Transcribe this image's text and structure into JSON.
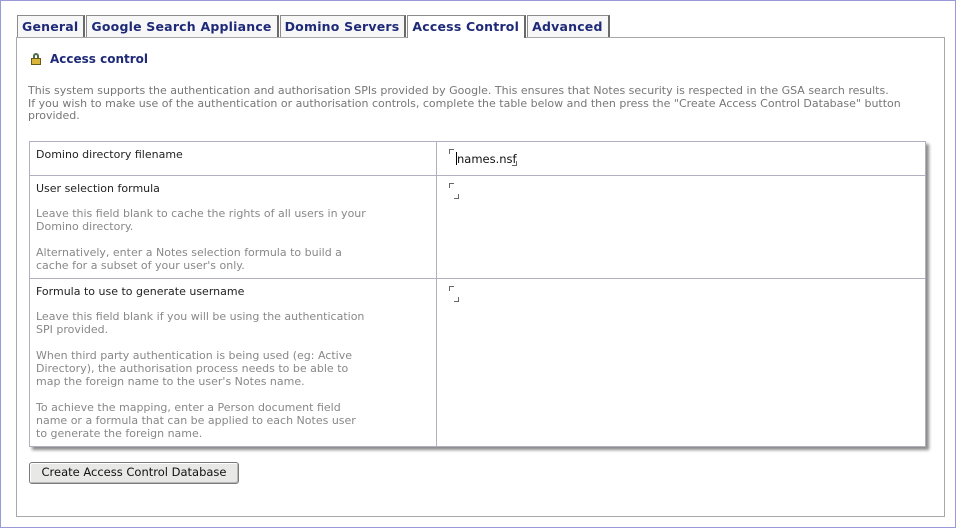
{
  "tabs": [
    {
      "label": "General",
      "active": false
    },
    {
      "label": "Google Search Appliance",
      "active": false
    },
    {
      "label": "Domino Servers",
      "active": false
    },
    {
      "label": "Access Control",
      "active": true
    },
    {
      "label": "Advanced",
      "active": false
    }
  ],
  "section": {
    "title": "Access control",
    "icon": "lock-icon"
  },
  "intro": {
    "line1": "This system supports the authentication and authorisation SPIs provided by Google. This ensures that Notes security is respected in the GSA search results.",
    "line2": "If you wish to make use of the authentication or authorisation controls, complete the table below and then press the \"Create Access Control Database\" button provided."
  },
  "form": {
    "domino_directory": {
      "label": "Domino directory filename",
      "value": "names.nsf"
    },
    "user_selection": {
      "label": "User selection formula",
      "help1": "Leave this field blank to cache the rights of all users in your Domino directory.",
      "help2": "Alternatively, enter a Notes selection formula to build a cache for a subset of your user's only.",
      "value": ""
    },
    "username_formula": {
      "label": "Formula to use to generate username",
      "help1": "Leave this field blank if you will be using the authentication SPI provided.",
      "help2": "When third party authentication is being used (eg: Active Directory), the authorisation process needs to be able to map the foreign name to the user's Notes name.",
      "help3": "To achieve the mapping, enter a Person document field name or a formula that can be applied to each Notes user to generate the foreign name.",
      "value": ""
    }
  },
  "actions": {
    "create_label": "Create Access Control Database"
  }
}
